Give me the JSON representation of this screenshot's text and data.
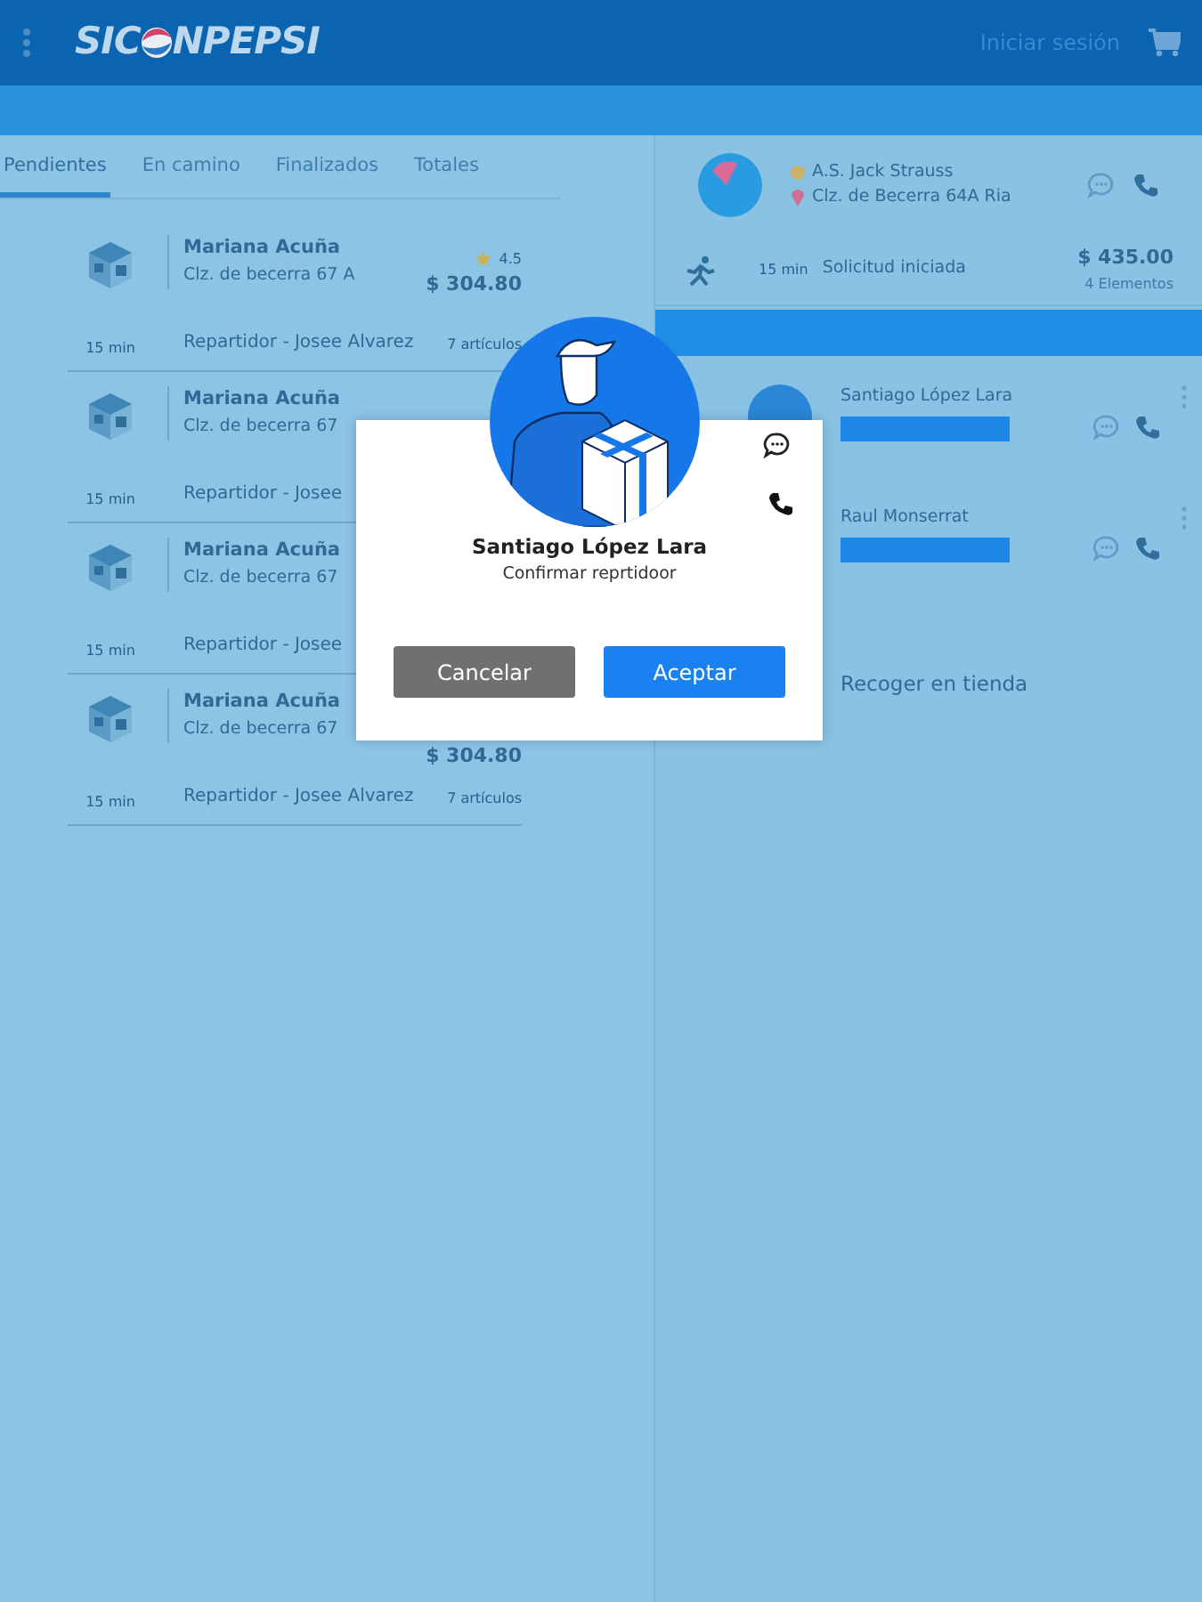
{
  "header": {
    "logo": {
      "before": "SIC",
      "after": "NPEPSI"
    },
    "login": "Iniciar sesión"
  },
  "tabs": [
    {
      "label": "Pendientes",
      "selected": true
    },
    {
      "label": "En camino",
      "selected": false
    },
    {
      "label": "Finalizados",
      "selected": false
    },
    {
      "label": "Totales",
      "selected": false
    }
  ],
  "orders": [
    {
      "name": "Mariana Acuña",
      "address": "Clz. de becerra 67 A",
      "rating": "4.5",
      "price": "$ 304.80",
      "count": "7 artículos",
      "time": "15 min",
      "courier": "Repartidor - Josee Alvarez"
    },
    {
      "name": "Mariana Acuña",
      "address": "Clz. de becerra 67",
      "time": "15 min",
      "courier": "Repartidor - Josee"
    },
    {
      "name": "Mariana Acuña",
      "address": "Clz. de becerra 67",
      "time": "15 min",
      "courier": "Repartidor - Josee"
    },
    {
      "name": "Mariana Acuña",
      "address": "Clz. de becerra 67",
      "price": "$ 304.80",
      "count": "7 artículos",
      "time": "15 min",
      "courier": "Repartidor - Josee Alvarez"
    }
  ],
  "customer": {
    "name": "A.S. Jack Strauss",
    "address": "Clz. de Becerra 64A Ria"
  },
  "order_summary": {
    "time": "15 min",
    "status": "Solicitud iniciada",
    "total": "$ 435.00",
    "items": "4 Elementos"
  },
  "drivers": [
    {
      "name": "Santiago López Lara"
    },
    {
      "name": "Raul Monserrat"
    }
  ],
  "pickup": "Recoger en tienda",
  "dialog": {
    "name": "Santiago López Lara",
    "subtitle": "Confirmar reprtidoor",
    "buttons": [
      {
        "label": "Cancelar",
        "kind": "secondary"
      },
      {
        "label": "Aceptar",
        "kind": "primary"
      }
    ]
  }
}
